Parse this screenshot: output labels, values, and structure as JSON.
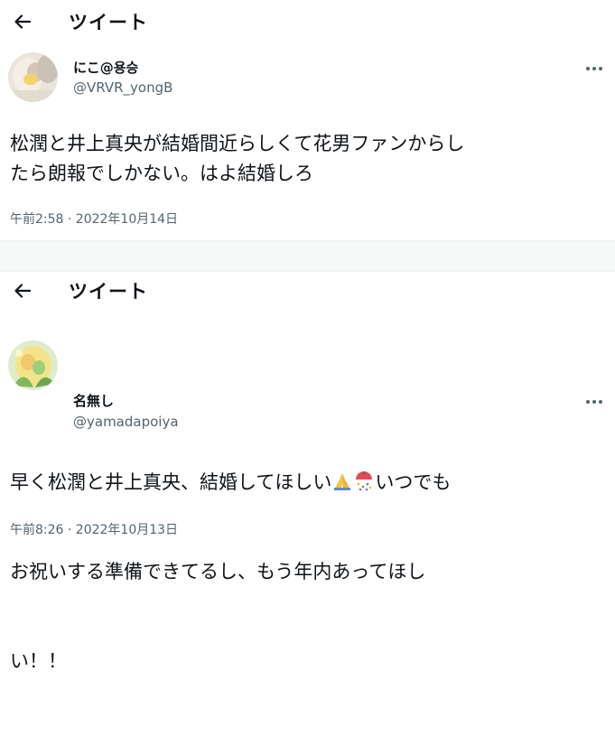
{
  "tweets": [
    {
      "header_title": "ツイート",
      "display_name": "にこ@용승",
      "handle": "@VRVR_yongB",
      "text": "松潤と井上真央が結婚間近らしくて花男ファンからし\nたら朗報でしかない。はよ結婚しろ",
      "timestamp": "午前2:58 · 2022年10月14日",
      "back_icon": "back-arrow-icon",
      "more_icon": "more-dots-icon"
    },
    {
      "header_title": "ツイート",
      "display_name": "名無し",
      "handle": "@yamadapoiya",
      "text_line1_a": "早く松潤と井上真央、結婚してほしい",
      "text_line1_b": "いつでも",
      "text_line2": "お祝いする準備できてるし、もう年内あってほし",
      "text_line3": "い！！",
      "timestamp": "午前8:26 · 2022年10月13日",
      "emojis": [
        "folded-hands-emoji",
        "confetti-ball-emoji"
      ],
      "back_icon": "back-arrow-icon",
      "more_icon": "more-dots-icon"
    }
  ],
  "colors": {
    "text": "#0f1419",
    "secondary": "#536471",
    "divider_band": "#f7f9f9"
  }
}
